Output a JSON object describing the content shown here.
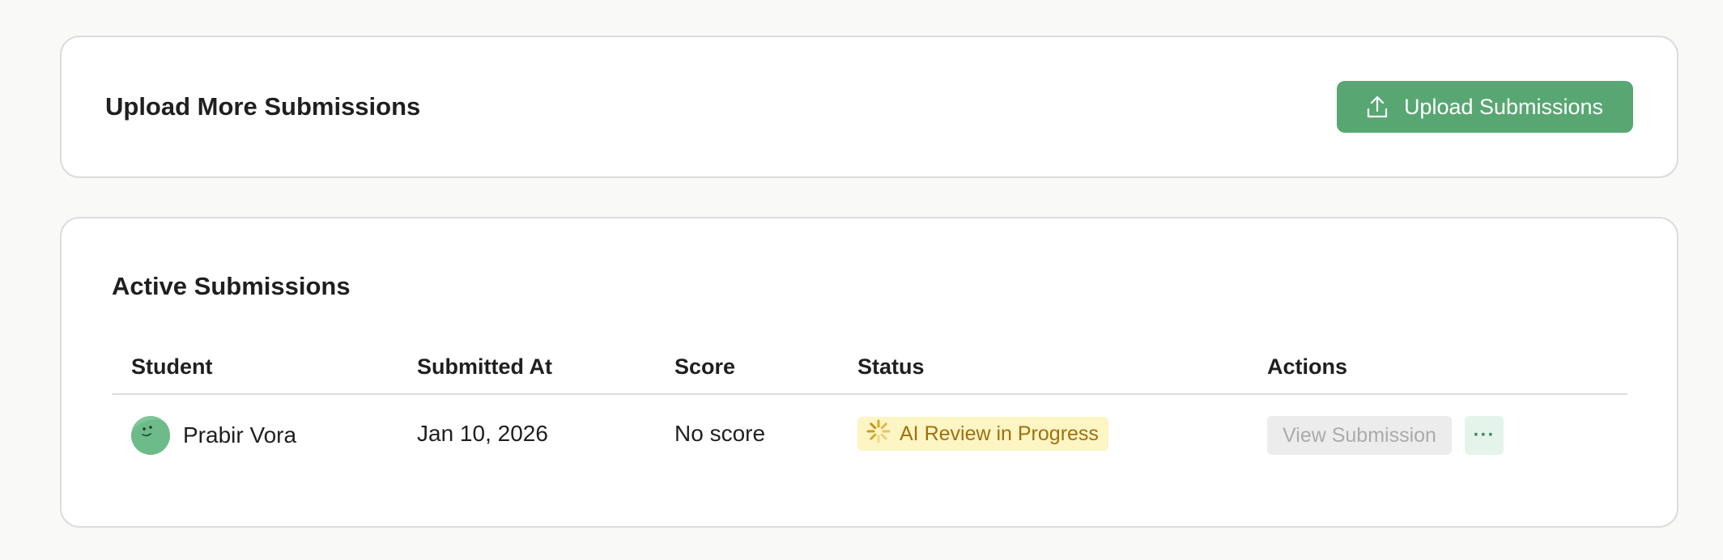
{
  "upload_section": {
    "title": "Upload More Submissions",
    "button_label": "Upload Submissions",
    "button_icon": "upload-icon"
  },
  "active_section": {
    "title": "Active Submissions",
    "columns": {
      "student": "Student",
      "submitted_at": "Submitted At",
      "score": "Score",
      "status": "Status",
      "actions": "Actions"
    },
    "rows": [
      {
        "student_name": "Prabir Vora",
        "submitted_at": "Jan 10, 2026",
        "score": "No score",
        "status": "AI Review in Progress",
        "view_label": "View Submission",
        "more_label": "···"
      }
    ]
  },
  "colors": {
    "accent_green": "#58a773",
    "status_bg": "#fdf5c3",
    "status_text": "#a0700e"
  }
}
